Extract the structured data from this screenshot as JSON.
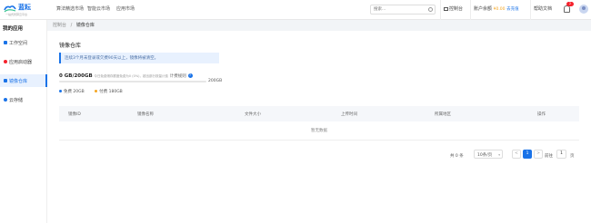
{
  "brand": {
    "name": "蓝耘",
    "tagline": "一站式智算云平台"
  },
  "top_nav": [
    "算法精选市场",
    "智能云市场",
    "应用市场"
  ],
  "search": {
    "placeholder": "搜索..."
  },
  "header": {
    "console": "控制台",
    "account": "账户余额",
    "balance": "¥0.00",
    "recharge": "去充值",
    "help": "帮助文档",
    "notification_count": "2"
  },
  "sidebar": {
    "title": "我的应用",
    "items": [
      {
        "label": "工作空间",
        "icon": "workspace-icon",
        "color": "#1a73e8"
      },
      {
        "label": "应用启动器",
        "icon": "app-launcher-icon",
        "color": "#f5222d"
      },
      {
        "label": "镜像仓库",
        "icon": "image-repo-icon",
        "color": "#1a73e8",
        "active": true
      },
      {
        "label": "云存储",
        "icon": "cloud-storage-icon",
        "color": "#1a73e8"
      }
    ]
  },
  "breadcrumb": {
    "root": "控制台",
    "sep": "/",
    "current": "镜像仓库"
  },
  "main": {
    "title": "镜像仓库",
    "notice": "连续3个月未登录或欠费90天以上，镜像将被清空。",
    "storage": {
      "used": "0 GB/200GB",
      "hint": "今日免费储存额度免费为0 (0%)，超出部分按量计费",
      "billing": "计费规则",
      "max": "200GB",
      "used_fraction": 0
    },
    "legend": [
      {
        "label": "免费 20GB",
        "color": "#1a73e8"
      },
      {
        "label": "付费 180GB",
        "color": "#f5a623"
      }
    ],
    "table": {
      "columns": [
        "镜像ID",
        "镜像名称",
        "文件大小",
        "上传时间",
        "所属地区",
        "操作"
      ],
      "empty": "暂无数据"
    }
  },
  "pagination": {
    "total": "共 0 条",
    "page_size": "10条/页",
    "prev": "<",
    "current": "1",
    "next": ">",
    "goto": "前往",
    "goto_value": "1",
    "page_suffix": "页"
  },
  "colors": {
    "accent": "#1a73e8",
    "warning": "#f5a623",
    "danger": "#f5222d"
  }
}
